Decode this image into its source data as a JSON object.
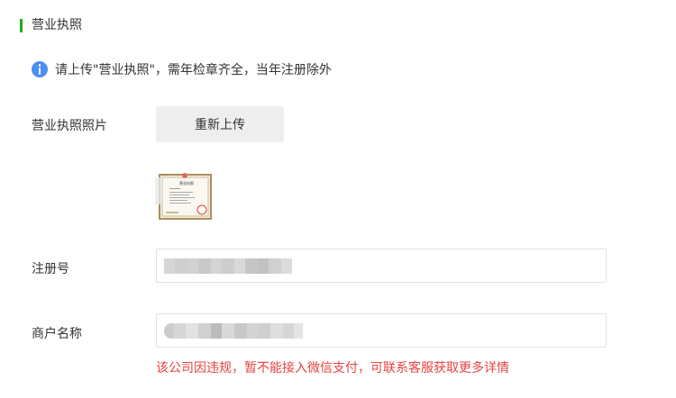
{
  "section": {
    "title": "营业执照"
  },
  "notice": {
    "icon": "info-icon",
    "text": "请上传\"营业执照\"，需年检章齐全，当年注册除外"
  },
  "photo_field": {
    "label": "营业执照照片",
    "button_label": "重新上传",
    "thumbnail_text": "营业执照"
  },
  "registration_field": {
    "label": "注册号",
    "value_state": "redacted"
  },
  "merchant_field": {
    "label": "商户名称",
    "value_state": "redacted",
    "error_message": "该公司因违规，暂不能接入微信支付，可联系客服获取更多详情"
  },
  "colors": {
    "accent_green": "#1aad19",
    "info_blue": "#4a8ef2",
    "error_red": "#e64340",
    "button_bg": "#eeeeee",
    "input_border": "#e2e2e2"
  }
}
